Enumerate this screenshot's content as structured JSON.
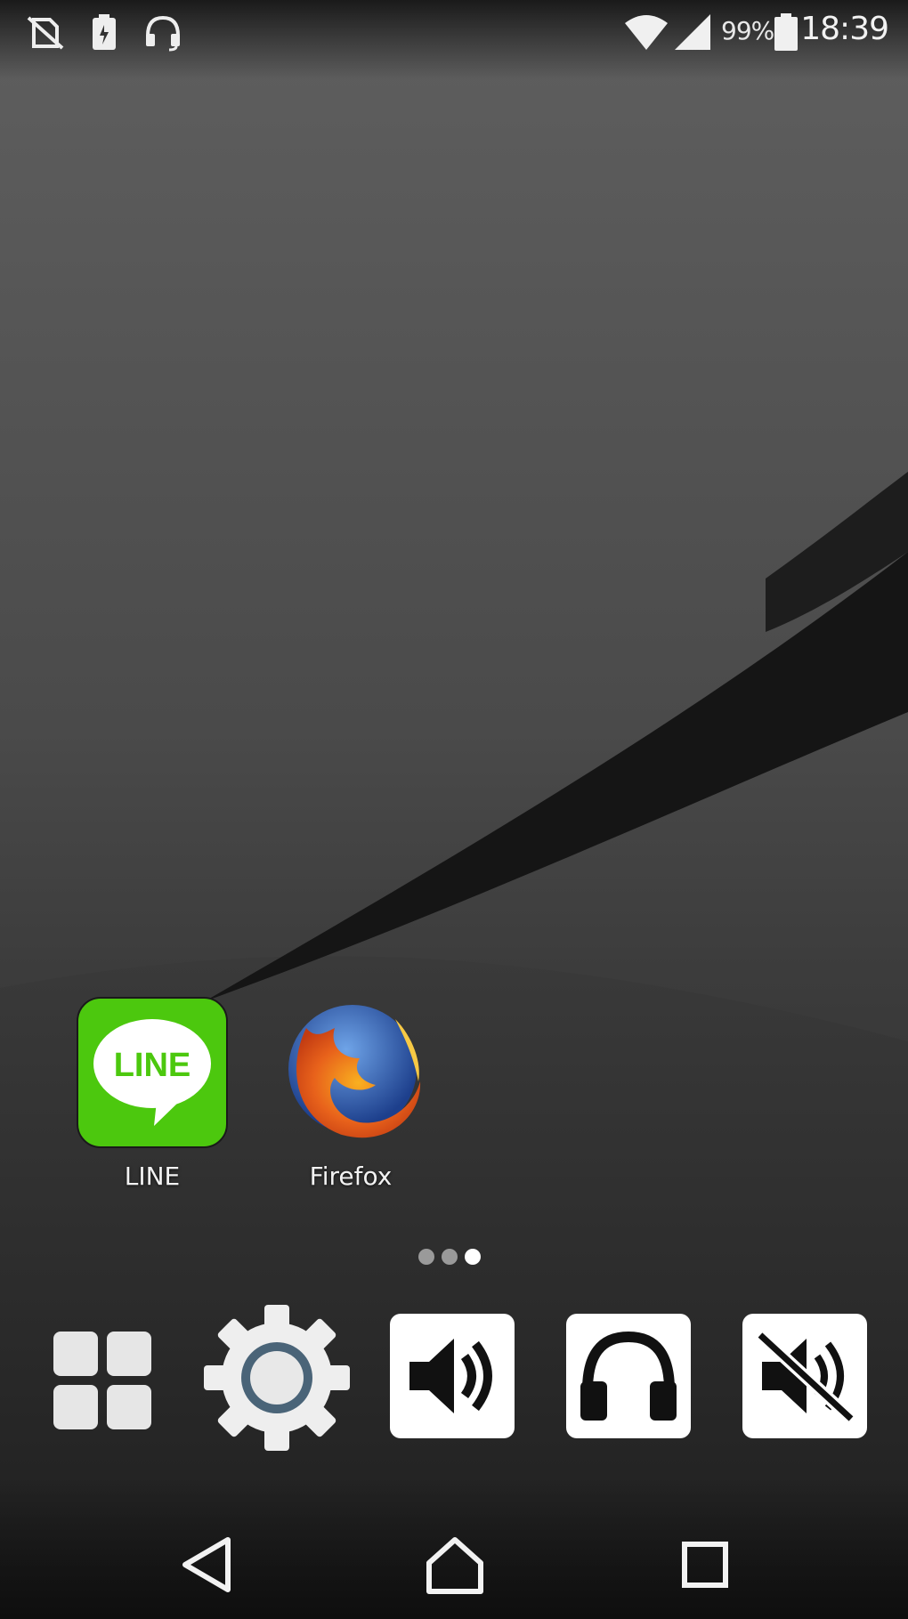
{
  "status_bar": {
    "time": "18:39",
    "battery_percent": "99%",
    "left_icons": [
      "no-sim-icon",
      "battery-saver-icon",
      "headset-mic-icon"
    ],
    "right_icons": [
      "wifi-icon",
      "cell-signal-icon",
      "battery-icon"
    ]
  },
  "home": {
    "apps": [
      {
        "label": "LINE",
        "icon": "line-app-icon",
        "icon_text": "LINE",
        "color": "#4cc80e"
      },
      {
        "label": "Firefox",
        "icon": "firefox-app-icon",
        "color": "#e8621b"
      }
    ],
    "page_indicator": {
      "pages": 3,
      "current": 3
    }
  },
  "dock": {
    "items": [
      "app-drawer-icon",
      "settings-icon",
      "speaker-icon",
      "headphone-icon",
      "mute-icon"
    ]
  },
  "navigation": {
    "buttons": [
      "back-icon",
      "home-icon",
      "recents-icon"
    ]
  },
  "colors": {
    "line_green": "#4cc80e",
    "settings_ring": "#4a6478",
    "firefox_orange": "#e8621b",
    "firefox_blue": "#2d5fb5"
  }
}
